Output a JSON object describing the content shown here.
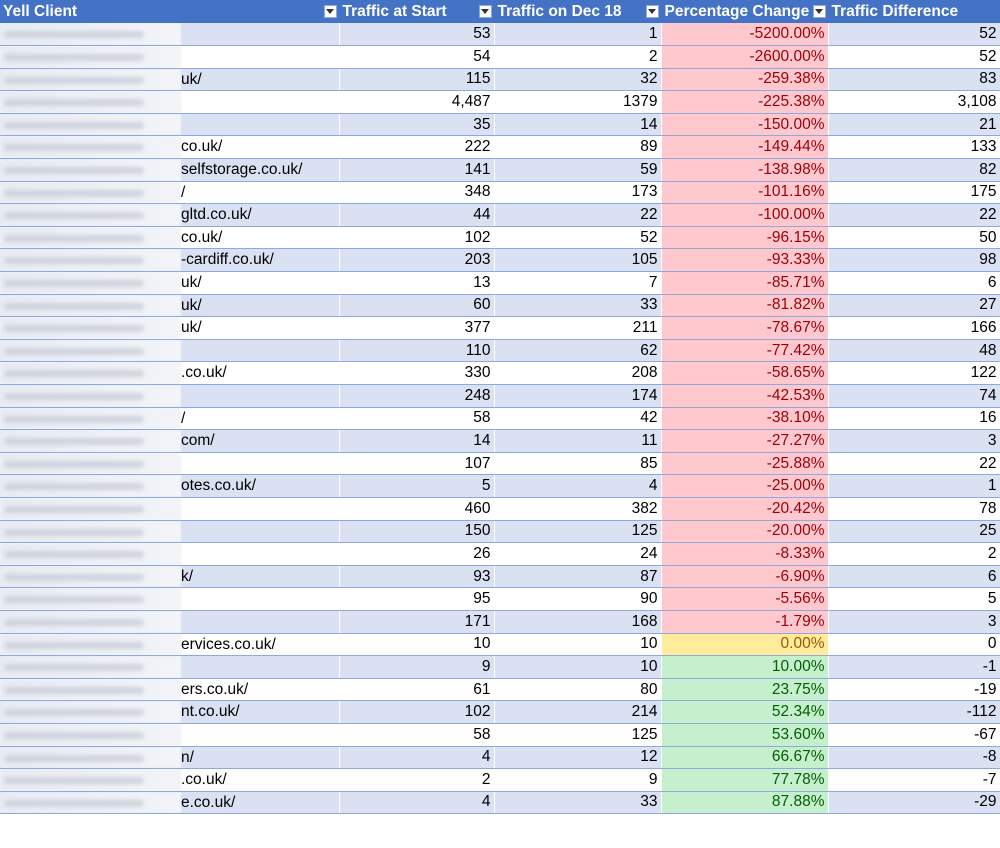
{
  "header": {
    "col1": "Yell Client",
    "col2": "Traffic at Start",
    "col3": "Traffic on Dec 18",
    "col4": "Percentage Change",
    "col5": "Traffic Difference"
  },
  "colors": {
    "header": "#4472c4",
    "band": "#d9e1f2",
    "neg": "#ffc7ce",
    "zero": "#ffeb9c",
    "pos": "#c6efce"
  },
  "rows": [
    {
      "client": "",
      "start": "53",
      "dec": "1",
      "pct": "-5200.00%",
      "diff": "52",
      "tone": "neg"
    },
    {
      "client": "",
      "start": "54",
      "dec": "2",
      "pct": "-2600.00%",
      "diff": "52",
      "tone": "neg"
    },
    {
      "client": "uk/",
      "start": "115",
      "dec": "32",
      "pct": "-259.38%",
      "diff": "83",
      "tone": "neg"
    },
    {
      "client": "",
      "start": "4,487",
      "dec": "1379",
      "pct": "-225.38%",
      "diff": "3,108",
      "tone": "neg"
    },
    {
      "client": "",
      "start": "35",
      "dec": "14",
      "pct": "-150.00%",
      "diff": "21",
      "tone": "neg"
    },
    {
      "client": "co.uk/",
      "start": "222",
      "dec": "89",
      "pct": "-149.44%",
      "diff": "133",
      "tone": "neg"
    },
    {
      "client": "selfstorage.co.uk/",
      "start": "141",
      "dec": "59",
      "pct": "-138.98%",
      "diff": "82",
      "tone": "neg"
    },
    {
      "client": "/",
      "start": "348",
      "dec": "173",
      "pct": "-101.16%",
      "diff": "175",
      "tone": "neg"
    },
    {
      "client": "gltd.co.uk/",
      "start": "44",
      "dec": "22",
      "pct": "-100.00%",
      "diff": "22",
      "tone": "neg"
    },
    {
      "client": "co.uk/",
      "start": "102",
      "dec": "52",
      "pct": "-96.15%",
      "diff": "50",
      "tone": "neg"
    },
    {
      "client": "-cardiff.co.uk/",
      "start": "203",
      "dec": "105",
      "pct": "-93.33%",
      "diff": "98",
      "tone": "neg"
    },
    {
      "client": "uk/",
      "start": "13",
      "dec": "7",
      "pct": "-85.71%",
      "diff": "6",
      "tone": "neg"
    },
    {
      "client": "uk/",
      "start": "60",
      "dec": "33",
      "pct": "-81.82%",
      "diff": "27",
      "tone": "neg"
    },
    {
      "client": "uk/",
      "start": "377",
      "dec": "211",
      "pct": "-78.67%",
      "diff": "166",
      "tone": "neg"
    },
    {
      "client": "",
      "start": "110",
      "dec": "62",
      "pct": "-77.42%",
      "diff": "48",
      "tone": "neg"
    },
    {
      "client": ".co.uk/",
      "start": "330",
      "dec": "208",
      "pct": "-58.65%",
      "diff": "122",
      "tone": "neg"
    },
    {
      "client": "",
      "start": "248",
      "dec": "174",
      "pct": "-42.53%",
      "diff": "74",
      "tone": "neg"
    },
    {
      "client": "/",
      "start": "58",
      "dec": "42",
      "pct": "-38.10%",
      "diff": "16",
      "tone": "neg"
    },
    {
      "client": "com/",
      "start": "14",
      "dec": "11",
      "pct": "-27.27%",
      "diff": "3",
      "tone": "neg"
    },
    {
      "client": "",
      "start": "107",
      "dec": "85",
      "pct": "-25.88%",
      "diff": "22",
      "tone": "neg"
    },
    {
      "client": "otes.co.uk/",
      "start": "5",
      "dec": "4",
      "pct": "-25.00%",
      "diff": "1",
      "tone": "neg"
    },
    {
      "client": "",
      "start": "460",
      "dec": "382",
      "pct": "-20.42%",
      "diff": "78",
      "tone": "neg"
    },
    {
      "client": "",
      "start": "150",
      "dec": "125",
      "pct": "-20.00%",
      "diff": "25",
      "tone": "neg"
    },
    {
      "client": "",
      "start": "26",
      "dec": "24",
      "pct": "-8.33%",
      "diff": "2",
      "tone": "neg"
    },
    {
      "client": "k/",
      "start": "93",
      "dec": "87",
      "pct": "-6.90%",
      "diff": "6",
      "tone": "neg"
    },
    {
      "client": "",
      "start": "95",
      "dec": "90",
      "pct": "-5.56%",
      "diff": "5",
      "tone": "neg"
    },
    {
      "client": "",
      "start": "171",
      "dec": "168",
      "pct": "-1.79%",
      "diff": "3",
      "tone": "neg"
    },
    {
      "client": "ervices.co.uk/",
      "start": "10",
      "dec": "10",
      "pct": "0.00%",
      "diff": "0",
      "tone": "zero"
    },
    {
      "client": "",
      "start": "9",
      "dec": "10",
      "pct": "10.00%",
      "diff": "-1",
      "tone": "pos"
    },
    {
      "client": "ers.co.uk/",
      "start": "61",
      "dec": "80",
      "pct": "23.75%",
      "diff": "-19",
      "tone": "pos"
    },
    {
      "client": "nt.co.uk/",
      "start": "102",
      "dec": "214",
      "pct": "52.34%",
      "diff": "-112",
      "tone": "pos"
    },
    {
      "client": "",
      "start": "58",
      "dec": "125",
      "pct": "53.60%",
      "diff": "-67",
      "tone": "pos"
    },
    {
      "client": "n/",
      "start": "4",
      "dec": "12",
      "pct": "66.67%",
      "diff": "-8",
      "tone": "pos"
    },
    {
      "client": ".co.uk/",
      "start": "2",
      "dec": "9",
      "pct": "77.78%",
      "diff": "-7",
      "tone": "pos"
    },
    {
      "client": "e.co.uk/",
      "start": "4",
      "dec": "33",
      "pct": "87.88%",
      "diff": "-29",
      "tone": "pos"
    }
  ]
}
